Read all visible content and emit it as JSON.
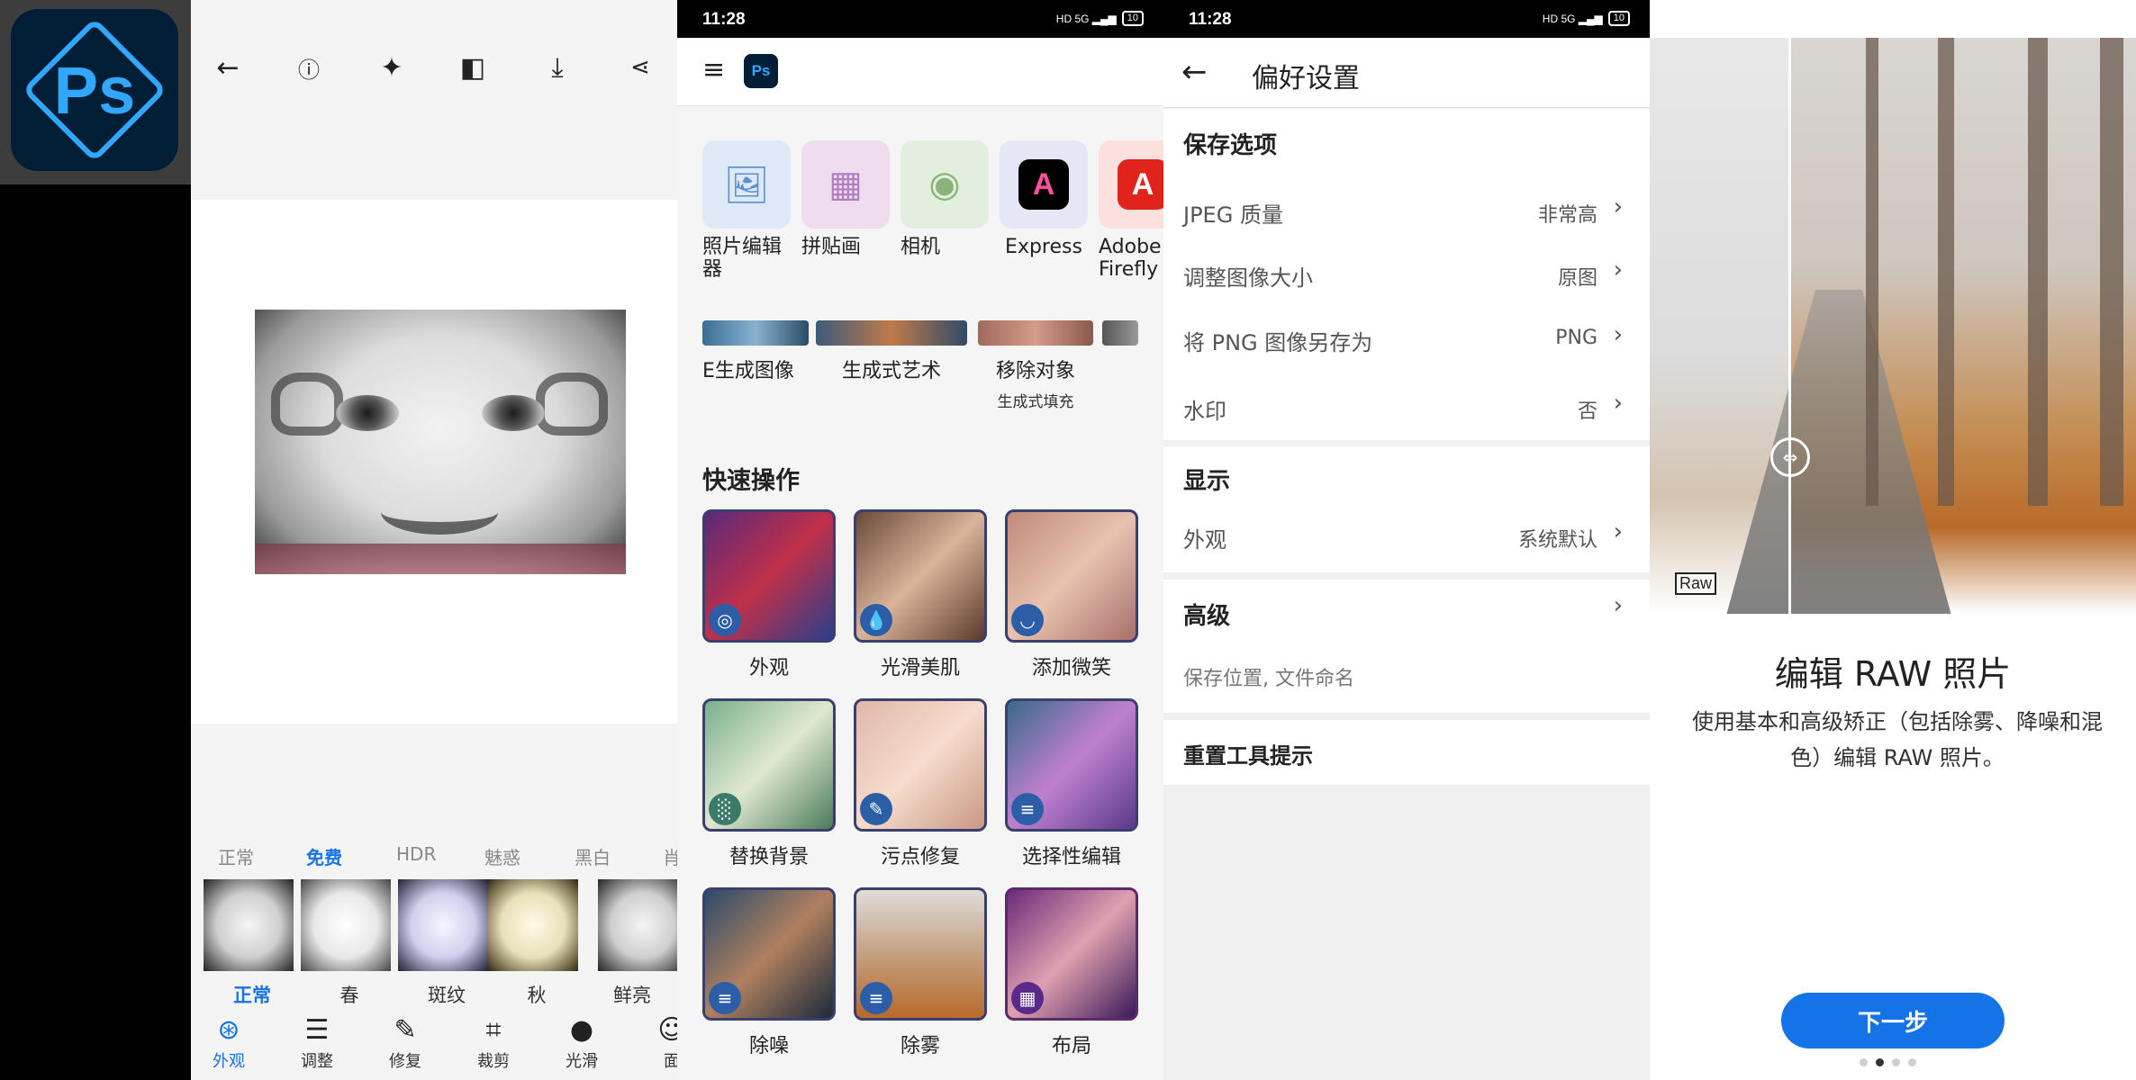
{
  "logo": {
    "text": "Ps"
  },
  "editor": {
    "filter_categories": [
      "正常",
      "免费",
      "HDR",
      "魅惑",
      "黑白",
      "肖"
    ],
    "active_category": "免费",
    "filter_names": [
      "正常",
      "春",
      "斑纹",
      "秋",
      "鲜亮"
    ],
    "active_filter": "正常",
    "bottom_tools": [
      {
        "label": "外观",
        "icon": "looks-icon"
      },
      {
        "label": "调整",
        "icon": "sliders-icon"
      },
      {
        "label": "修复",
        "icon": "bandage-icon"
      },
      {
        "label": "裁剪",
        "icon": "crop-icon"
      },
      {
        "label": "光滑",
        "icon": "drop-icon"
      },
      {
        "label": "面",
        "icon": "face-icon"
      }
    ]
  },
  "status": {
    "time": "11:28",
    "battery": "10"
  },
  "home": {
    "apps": [
      {
        "label": "照片编辑器",
        "color": "#dde9f7"
      },
      {
        "label": "拼贴画",
        "color": "#f0dcef"
      },
      {
        "label": "相机",
        "color": "#e3efde"
      },
      {
        "label": "Express",
        "color": "#e5e7f7"
      },
      {
        "label": "Adobe Firefly",
        "color": "#fbe0de"
      }
    ],
    "features": [
      {
        "label": "E生成图像",
        "sub": ""
      },
      {
        "label": "生成式艺术",
        "sub": ""
      },
      {
        "label": "移除对象",
        "sub": "生成式填充"
      }
    ],
    "quick_title": "快速操作",
    "quick_actions": [
      {
        "label": "外观",
        "badge": "◎"
      },
      {
        "label": "光滑美肌",
        "badge": "💧"
      },
      {
        "label": "添加微笑",
        "badge": "◡"
      },
      {
        "label": "替换背景",
        "badge": "░"
      },
      {
        "label": "污点修复",
        "badge": "✎"
      },
      {
        "label": "选择性编辑",
        "badge": "≡"
      },
      {
        "label": "除噪",
        "badge": "≡"
      },
      {
        "label": "除雾",
        "badge": "≡"
      },
      {
        "label": "布局",
        "badge": "▦"
      }
    ]
  },
  "prefs": {
    "title": "偏好设置",
    "save_section": "保存选项",
    "jpeg_label": "JPEG 质量",
    "jpeg_value": "非常高",
    "resize_label": "调整图像大小",
    "resize_value": "原图",
    "png_label": "将 PNG 图像另存为",
    "png_value": "PNG",
    "watermark_label": "水印",
    "watermark_value": "否",
    "display_section": "显示",
    "appearance_label": "外观",
    "appearance_value": "系统默认",
    "advanced_section": "高级",
    "advanced_sub": "保存位置, 文件命名",
    "reset_label": "重置工具提示"
  },
  "onboard": {
    "raw_tag": "Raw",
    "title": "编辑 RAW 照片",
    "desc": "使用基本和高级矫正（包括除雾、降噪和混色）编辑 RAW 照片。",
    "next": "下一步",
    "page_index": 1,
    "page_count": 4
  }
}
